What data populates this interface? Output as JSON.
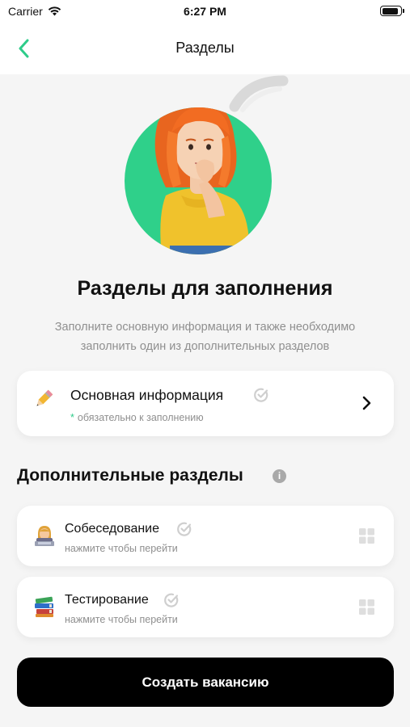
{
  "status_bar": {
    "carrier": "Carrier",
    "time": "6:27 PM",
    "battery_level": 0.9
  },
  "nav": {
    "title": "Разделы",
    "back_icon": "chevron-left-icon",
    "accent_color": "#2ecc8a"
  },
  "hero": {
    "illustration": "thinking-woman-illustration",
    "circle_color": "#2fd08a"
  },
  "heading": "Разделы для заполнения",
  "subtitle": "Заполните основную информация и также необходимо заполнить один из дополнительных разделов",
  "main_section": {
    "icon": "pencil-icon",
    "title": "Основная информация",
    "note_marker": "*",
    "note": "обязательно к заполнению"
  },
  "additional": {
    "title": "Дополнительные разделы",
    "info_glyph": "i",
    "items": [
      {
        "icon": "woman-technologist-icon",
        "title": "Собеседование",
        "hint": "нажмите чтобы перейти"
      },
      {
        "icon": "books-icon",
        "title": "Тестирование",
        "hint": "нажмите чтобы перейти"
      }
    ]
  },
  "primary_button": {
    "label": "Создать вакансию",
    "color": "#000000"
  }
}
